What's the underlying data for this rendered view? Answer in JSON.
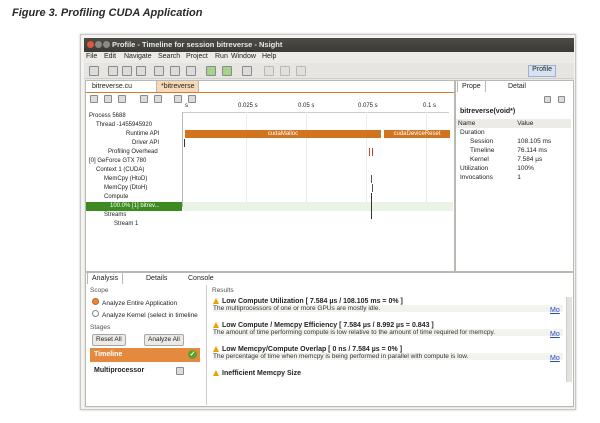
{
  "caption": "Figure 3. Profiling CUDA Application",
  "window": {
    "title": "Profile - Timeline for session bitreverse - Nsight",
    "menu": [
      "File",
      "Edit",
      "Navigate",
      "Search",
      "Project",
      "Run",
      "Window",
      "Help"
    ],
    "perspective": "Profile"
  },
  "editor": {
    "tabs": [
      "bitreverse.cu",
      "*bitreverse"
    ],
    "ruler": [
      "s",
      "0.025 s",
      "0.05 s",
      "0.075 s",
      "0.1 s"
    ],
    "rows": [
      "Process 5688",
      "Thread -1455945920",
      "Runtime API",
      "Driver API",
      "Profiling Overhead",
      "[0] GeForce GTX 780",
      "Context 1 (CUDA)",
      "MemCpy (HtoD)",
      "MemCpy (DtoH)",
      "Compute",
      "100.0% [1] bitrev...",
      "Streams",
      "Stream 1"
    ],
    "bars": {
      "cuda_malloc": "cudaMalloc",
      "cuda_reset": "cudaDeviceReset"
    }
  },
  "properties": {
    "tabs": [
      "Prope",
      "Detail"
    ],
    "function": "bitreverse(void*)",
    "headers": [
      "Name",
      "Value"
    ],
    "rows": [
      {
        "name": "Duration",
        "value": ""
      },
      {
        "name": "Session",
        "value": "108.105 ms"
      },
      {
        "name": "Timeline",
        "value": "76.114 ms"
      },
      {
        "name": "Kernel",
        "value": "7.584 µs"
      },
      {
        "name": "Utilization",
        "value": "100%"
      },
      {
        "name": "Invocations",
        "value": "1"
      }
    ]
  },
  "analysis": {
    "tabs": [
      "Analysis",
      "Details",
      "Console"
    ],
    "scope_label": "Scope",
    "scope_options": [
      "Analyze Entire Application",
      "Analyze Kernel (select in timeline"
    ],
    "stages_label": "Stages",
    "reset_label": "Reset All",
    "analyze_label": "Analyze All",
    "stages": [
      "Timeline",
      "Multiprocessor"
    ],
    "results_label": "Results",
    "results": [
      {
        "title": "Low Compute Utilization [ 7.584 µs / 108.105 ms = 0% ]",
        "desc": "The multiprocessors of one or more GPUs are mostly idle.",
        "more": "Mo"
      },
      {
        "title": "Low Compute / Memcpy Efficiency [ 7.584 µs / 8.992 µs = 0.843 ]",
        "desc": "The amount of time performing compute is low relative to the amount of time required for memcpy.",
        "more": "Mo"
      },
      {
        "title": "Low Memcpy/Compute Overlap [ 0 ns / 7.584 µs = 0% ]",
        "desc": "The percentage of time when memcpy is being performed in parallel with compute is low.",
        "more": "Mo"
      },
      {
        "title": "Inefficient Memcpy Size",
        "desc": "",
        "more": ""
      }
    ]
  },
  "colors": {
    "accent_orange": "#d8782a",
    "stage_green": "#5aa02c",
    "titlebar": "#403f3b"
  }
}
